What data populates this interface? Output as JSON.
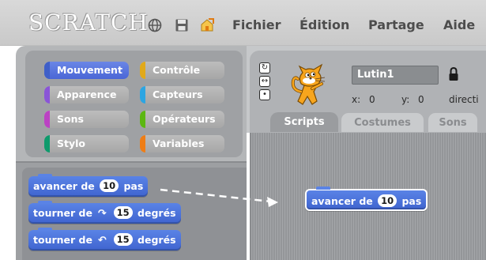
{
  "app": {
    "logo": "SCRATCH"
  },
  "menu": {
    "file": "Fichier",
    "edit": "Édition",
    "share": "Partage",
    "help": "Aide"
  },
  "categories": [
    {
      "label": "Mouvement",
      "color": "#4a6cd4"
    },
    {
      "label": "Contrôle",
      "color": "#e1a91a"
    },
    {
      "label": "Apparence",
      "color": "#8a55d7"
    },
    {
      "label": "Capteurs",
      "color": "#2ca5e2"
    },
    {
      "label": "Sons",
      "color": "#bb42c3"
    },
    {
      "label": "Opérateurs",
      "color": "#5cb712"
    },
    {
      "label": "Stylo",
      "color": "#0e9a6c"
    },
    {
      "label": "Variables",
      "color": "#ee7d16"
    }
  ],
  "selected_category": "Mouvement",
  "palette_blocks": [
    {
      "prefix": "avancer de",
      "value": "10",
      "suffix": "pas"
    },
    {
      "prefix": "tourner de",
      "icon": "↷",
      "value": "15",
      "suffix": "degrés"
    },
    {
      "prefix": "tourner de",
      "icon": "↶",
      "value": "15",
      "suffix": "degrés"
    }
  ],
  "sprite": {
    "name": "Lutin1",
    "x_label": "x:",
    "x_value": "0",
    "y_label": "y:",
    "y_value": "0",
    "direction_label": "directi"
  },
  "tabs": [
    {
      "label": "Scripts",
      "active": true
    },
    {
      "label": "Costumes",
      "active": false
    },
    {
      "label": "Sons",
      "active": false
    }
  ],
  "script_block": {
    "prefix": "avancer de",
    "value": "10",
    "suffix": "pas"
  },
  "icons": {
    "globe": "globe-icon",
    "save": "save-icon",
    "share": "share-icon",
    "lock": "lock-icon",
    "rotation_full": "rotate-full-icon",
    "rotation_lr": "rotate-left-right-icon",
    "rotation_none": "no-rotate-icon"
  }
}
